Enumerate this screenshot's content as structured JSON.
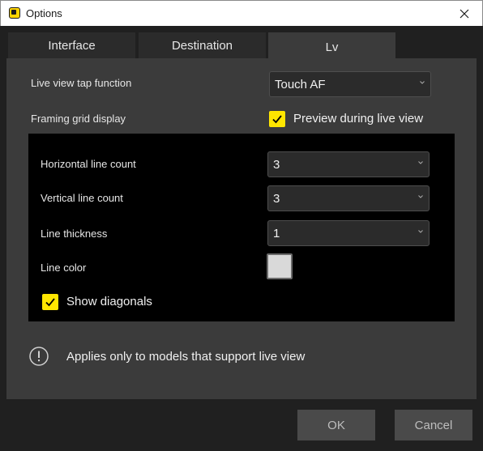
{
  "window": {
    "title": "Options",
    "close_glyph": "✕"
  },
  "tabs": [
    {
      "label": "Interface"
    },
    {
      "label": "Destination"
    },
    {
      "label": "Lv"
    }
  ],
  "active_tab": "Lv",
  "live_view_tap": {
    "label": "Live view tap function",
    "value": "Touch AF"
  },
  "framing_grid": {
    "label": "Framing grid display",
    "preview_checkbox": {
      "label": "Preview during live view",
      "checked": true
    }
  },
  "grid_settings": {
    "horizontal": {
      "label": "Horizontal line count",
      "value": "3"
    },
    "vertical": {
      "label": "Vertical line count",
      "value": "3"
    },
    "thickness": {
      "label": "Line thickness",
      "value": "1"
    },
    "color": {
      "label": "Line color",
      "swatch": "#d9d9d9"
    },
    "diagonals": {
      "label": "Show diagonals",
      "checked": true
    }
  },
  "note": {
    "icon": "exclamation-circle-icon",
    "text": "Applies only to models that support live view"
  },
  "buttons": {
    "ok": "OK",
    "cancel": "Cancel"
  },
  "colors": {
    "accent_checkbox": "#ffe600",
    "app_icon": "#ffd400"
  }
}
